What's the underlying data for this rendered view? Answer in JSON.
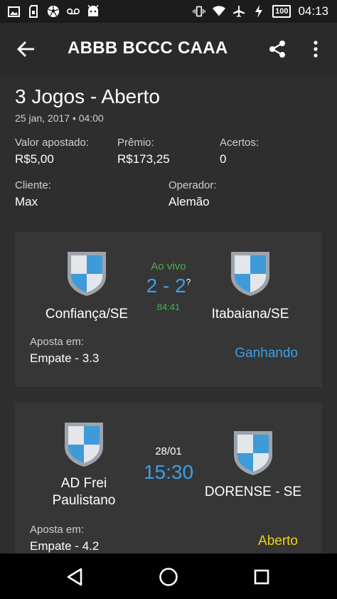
{
  "status_bar": {
    "time": "04:13",
    "battery": "100",
    "left_icons": [
      "image-icon",
      "sim-icon",
      "soccer-ball-icon",
      "voicemail-icon",
      "android-icon"
    ],
    "right_icons": [
      "vibrate-icon",
      "wifi-icon",
      "airplane-icon",
      "charging-icon"
    ]
  },
  "app_bar": {
    "title": "ABBB BCCC CAAA",
    "back_icon": "arrow-back-icon",
    "share_icon": "share-icon",
    "more_icon": "more-vert-icon"
  },
  "bet": {
    "title": "3 Jogos - Aberto",
    "datetime": "25 jan, 2017 • 04:00",
    "valor_label": "Valor apostado:",
    "valor_value": "R$5,00",
    "premio_label": "Prêmio:",
    "premio_value": "R$173,25",
    "acertos_label": "Acertos:",
    "acertos_value": "0",
    "cliente_label": "Cliente:",
    "cliente_value": "Max",
    "operador_label": "Operador:",
    "operador_value": "Alemão"
  },
  "games": [
    {
      "home_team": "Confiança/SE",
      "away_team": "Itabaiana/SE",
      "status_top": "Ao vivo",
      "score": "2 - 2",
      "score_mark": "?",
      "status_bottom": "84:41",
      "aposta_label": "Aposta em:",
      "aposta_value": "Empate - 3.3",
      "result": "Ganhando"
    },
    {
      "home_team_line1": "AD Frei",
      "home_team_line2": "Paulistano",
      "away_team": "DORENSE - SE",
      "date": "28/01",
      "time": "15:30",
      "aposta_label": "Aposta em:",
      "aposta_value": "Empate - 4.2",
      "result": "Aberto"
    }
  ],
  "colors": {
    "live_green": "#4caf50",
    "score_blue": "#3aa0e6",
    "winning_blue": "#3aa0e6",
    "open_yellow": "#e8d41a",
    "shield_blue": "#3f9ad8",
    "shield_gray": "#c8ccd2"
  },
  "nav_bar": {
    "back_icon": "nav-back-icon",
    "home_icon": "nav-home-icon",
    "recents_icon": "nav-recents-icon"
  }
}
